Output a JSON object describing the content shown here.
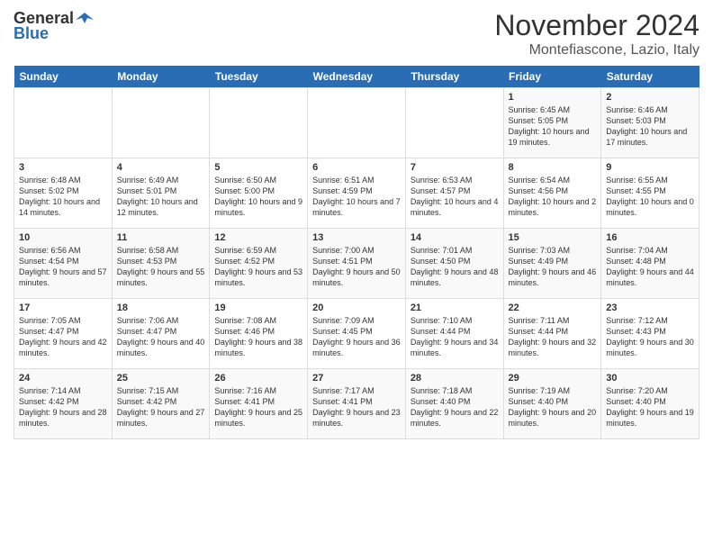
{
  "logo": {
    "general": "General",
    "blue": "Blue"
  },
  "title": "November 2024",
  "subtitle": "Montefiascone, Lazio, Italy",
  "headers": [
    "Sunday",
    "Monday",
    "Tuesday",
    "Wednesday",
    "Thursday",
    "Friday",
    "Saturday"
  ],
  "weeks": [
    [
      {
        "day": "",
        "info": ""
      },
      {
        "day": "",
        "info": ""
      },
      {
        "day": "",
        "info": ""
      },
      {
        "day": "",
        "info": ""
      },
      {
        "day": "",
        "info": ""
      },
      {
        "day": "1",
        "info": "Sunrise: 6:45 AM\nSunset: 5:05 PM\nDaylight: 10 hours and 19 minutes."
      },
      {
        "day": "2",
        "info": "Sunrise: 6:46 AM\nSunset: 5:03 PM\nDaylight: 10 hours and 17 minutes."
      }
    ],
    [
      {
        "day": "3",
        "info": "Sunrise: 6:48 AM\nSunset: 5:02 PM\nDaylight: 10 hours and 14 minutes."
      },
      {
        "day": "4",
        "info": "Sunrise: 6:49 AM\nSunset: 5:01 PM\nDaylight: 10 hours and 12 minutes."
      },
      {
        "day": "5",
        "info": "Sunrise: 6:50 AM\nSunset: 5:00 PM\nDaylight: 10 hours and 9 minutes."
      },
      {
        "day": "6",
        "info": "Sunrise: 6:51 AM\nSunset: 4:59 PM\nDaylight: 10 hours and 7 minutes."
      },
      {
        "day": "7",
        "info": "Sunrise: 6:53 AM\nSunset: 4:57 PM\nDaylight: 10 hours and 4 minutes."
      },
      {
        "day": "8",
        "info": "Sunrise: 6:54 AM\nSunset: 4:56 PM\nDaylight: 10 hours and 2 minutes."
      },
      {
        "day": "9",
        "info": "Sunrise: 6:55 AM\nSunset: 4:55 PM\nDaylight: 10 hours and 0 minutes."
      }
    ],
    [
      {
        "day": "10",
        "info": "Sunrise: 6:56 AM\nSunset: 4:54 PM\nDaylight: 9 hours and 57 minutes."
      },
      {
        "day": "11",
        "info": "Sunrise: 6:58 AM\nSunset: 4:53 PM\nDaylight: 9 hours and 55 minutes."
      },
      {
        "day": "12",
        "info": "Sunrise: 6:59 AM\nSunset: 4:52 PM\nDaylight: 9 hours and 53 minutes."
      },
      {
        "day": "13",
        "info": "Sunrise: 7:00 AM\nSunset: 4:51 PM\nDaylight: 9 hours and 50 minutes."
      },
      {
        "day": "14",
        "info": "Sunrise: 7:01 AM\nSunset: 4:50 PM\nDaylight: 9 hours and 48 minutes."
      },
      {
        "day": "15",
        "info": "Sunrise: 7:03 AM\nSunset: 4:49 PM\nDaylight: 9 hours and 46 minutes."
      },
      {
        "day": "16",
        "info": "Sunrise: 7:04 AM\nSunset: 4:48 PM\nDaylight: 9 hours and 44 minutes."
      }
    ],
    [
      {
        "day": "17",
        "info": "Sunrise: 7:05 AM\nSunset: 4:47 PM\nDaylight: 9 hours and 42 minutes."
      },
      {
        "day": "18",
        "info": "Sunrise: 7:06 AM\nSunset: 4:47 PM\nDaylight: 9 hours and 40 minutes."
      },
      {
        "day": "19",
        "info": "Sunrise: 7:08 AM\nSunset: 4:46 PM\nDaylight: 9 hours and 38 minutes."
      },
      {
        "day": "20",
        "info": "Sunrise: 7:09 AM\nSunset: 4:45 PM\nDaylight: 9 hours and 36 minutes."
      },
      {
        "day": "21",
        "info": "Sunrise: 7:10 AM\nSunset: 4:44 PM\nDaylight: 9 hours and 34 minutes."
      },
      {
        "day": "22",
        "info": "Sunrise: 7:11 AM\nSunset: 4:44 PM\nDaylight: 9 hours and 32 minutes."
      },
      {
        "day": "23",
        "info": "Sunrise: 7:12 AM\nSunset: 4:43 PM\nDaylight: 9 hours and 30 minutes."
      }
    ],
    [
      {
        "day": "24",
        "info": "Sunrise: 7:14 AM\nSunset: 4:42 PM\nDaylight: 9 hours and 28 minutes."
      },
      {
        "day": "25",
        "info": "Sunrise: 7:15 AM\nSunset: 4:42 PM\nDaylight: 9 hours and 27 minutes."
      },
      {
        "day": "26",
        "info": "Sunrise: 7:16 AM\nSunset: 4:41 PM\nDaylight: 9 hours and 25 minutes."
      },
      {
        "day": "27",
        "info": "Sunrise: 7:17 AM\nSunset: 4:41 PM\nDaylight: 9 hours and 23 minutes."
      },
      {
        "day": "28",
        "info": "Sunrise: 7:18 AM\nSunset: 4:40 PM\nDaylight: 9 hours and 22 minutes."
      },
      {
        "day": "29",
        "info": "Sunrise: 7:19 AM\nSunset: 4:40 PM\nDaylight: 9 hours and 20 minutes."
      },
      {
        "day": "30",
        "info": "Sunrise: 7:20 AM\nSunset: 4:40 PM\nDaylight: 9 hours and 19 minutes."
      }
    ]
  ]
}
